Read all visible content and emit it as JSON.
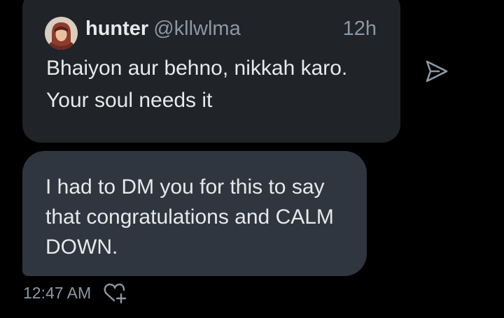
{
  "quoted_post": {
    "author_name": "hunter",
    "author_handle": "@kllwlma",
    "time_ago": "12h",
    "text": "Bhaiyon aur behno, nikkah karo. Your soul needs it",
    "avatar_icon": "user-avatar"
  },
  "message": {
    "text": "I had to DM you for this to say that congratulations and CALM DOWN.",
    "timestamp": "12:47 AM"
  },
  "icons": {
    "share": "send-icon",
    "reaction": "add-reaction-heart-icon"
  },
  "colors": {
    "background": "#000000",
    "quote_card": "#202327",
    "message_bubble": "#2f3640",
    "primary_text": "#e7e9ea",
    "secondary_text": "#8b98a5"
  }
}
